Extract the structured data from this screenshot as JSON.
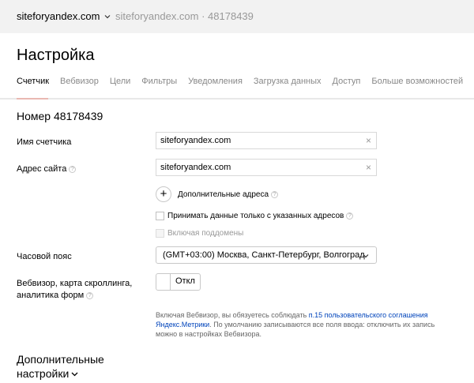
{
  "header": {
    "site_name": "siteforyandex.com",
    "site_sub": "siteforyandex.com · 48178439"
  },
  "page_title": "Настройка",
  "tabs": [
    {
      "label": "Счетчик",
      "active": true
    },
    {
      "label": "Вебвизор",
      "active": false
    },
    {
      "label": "Цели",
      "active": false
    },
    {
      "label": "Фильтры",
      "active": false
    },
    {
      "label": "Уведомления",
      "active": false
    },
    {
      "label": "Загрузка данных",
      "active": false
    },
    {
      "label": "Доступ",
      "active": false
    },
    {
      "label": "Больше возможностей",
      "active": false
    }
  ],
  "counter_title": "Номер 48178439",
  "form": {
    "name_label": "Имя счетчика",
    "name_value": "siteforyandex.com",
    "site_label": "Адрес сайта",
    "site_value": "siteforyandex.com",
    "add_addresses_label": "Дополнительные адреса",
    "only_specified_label": "Принимать данные только с указанных адресов",
    "include_subdomains_label": "Включая поддомены",
    "timezone_label": "Часовой пояс",
    "timezone_value": "(GMT+03:00) Москва, Санкт-Петербург, Волгоград",
    "webvisor_label_line1": "Вебвизор, карта скроллинга,",
    "webvisor_label_line2": "аналитика форм",
    "webvisor_toggle_text": "Откл",
    "clear_symbol": "×",
    "help_symbol": "?",
    "plus_symbol": "+"
  },
  "note": {
    "prefix": "Включая Вебвизор, вы обязуетесь соблюдать ",
    "link": "п.15 пользовательского соглашения Яндекс.Метрики",
    "suffix": ". По умолчанию записываются все поля ввода: отключить их запись можно в настройках Вебвизора."
  },
  "more_settings_line1": "Дополнительные",
  "more_settings_line2": "настройки",
  "colors": {
    "topbar_bg": "#f2f2f2",
    "active_tab_underline": "#e9b8b2",
    "link": "#0044bb"
  },
  "icons": {
    "site_dropdown": "chevron-down-icon",
    "clear": "close-icon",
    "help": "help-icon",
    "add": "plus-icon",
    "select": "chevron-down-icon",
    "more": "chevron-down-icon"
  }
}
